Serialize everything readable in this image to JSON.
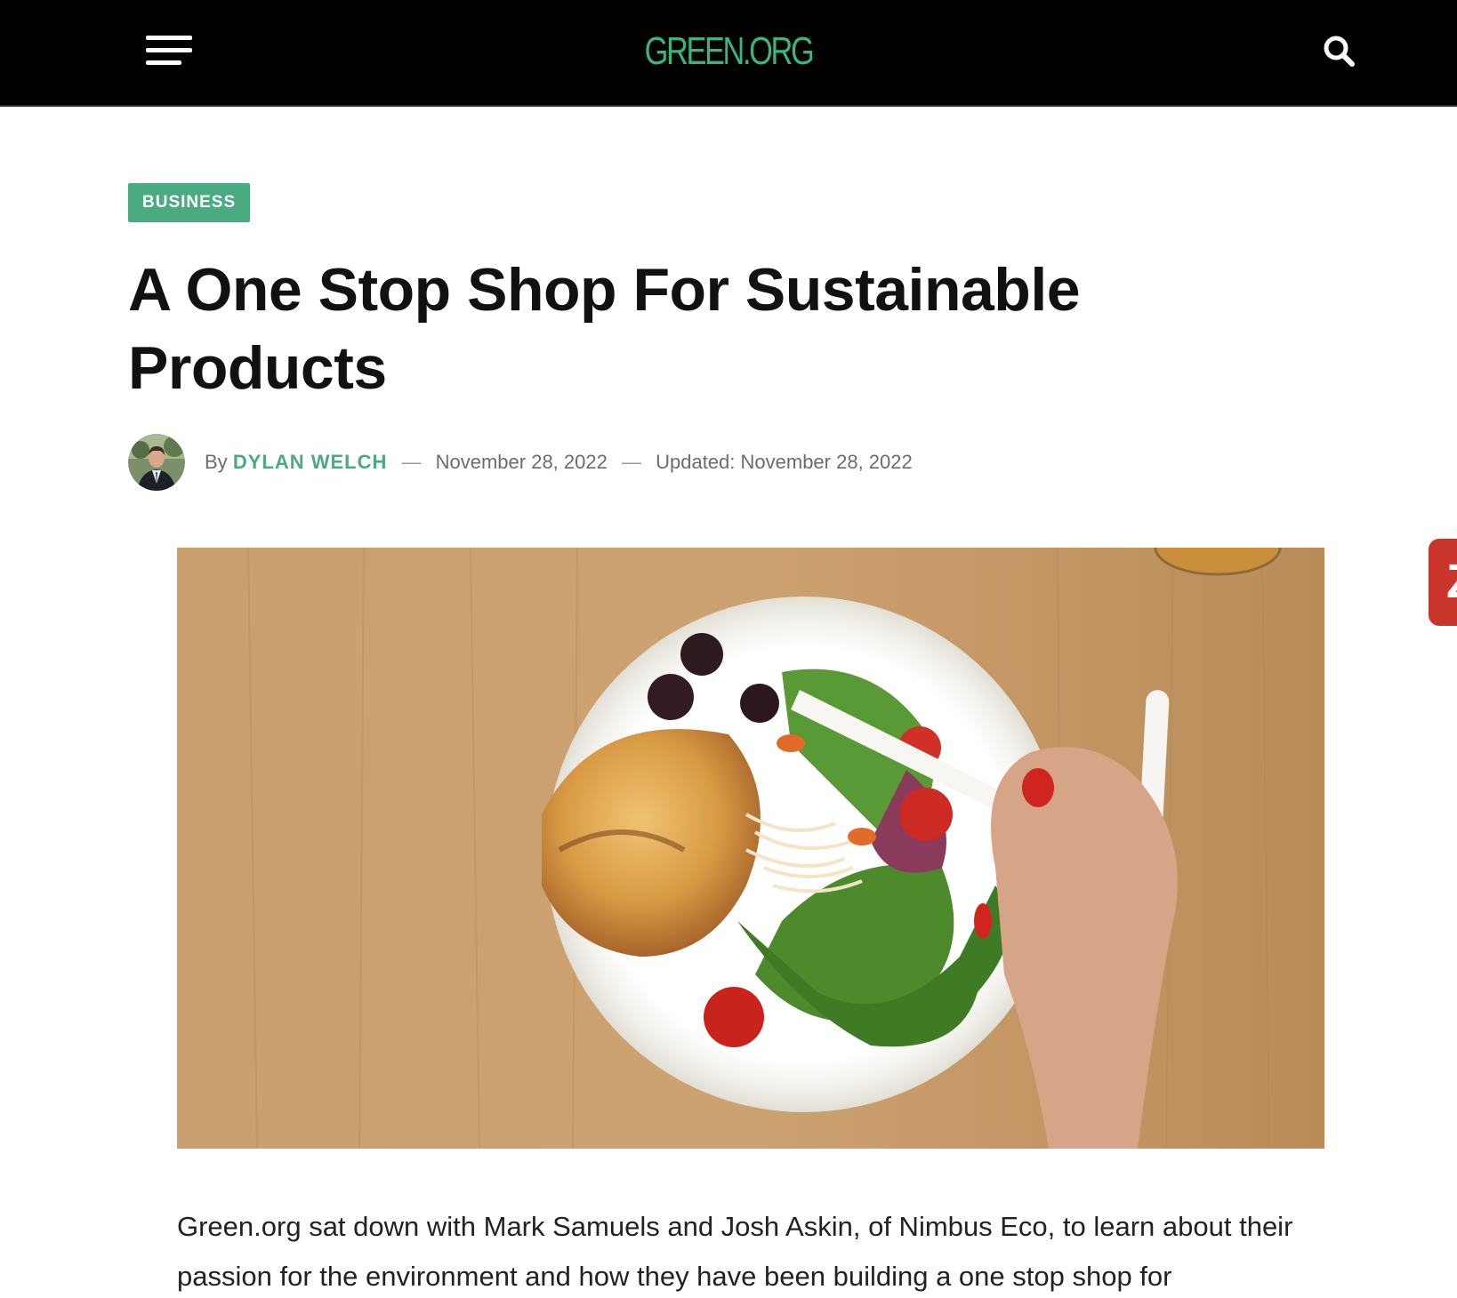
{
  "header": {
    "menu_icon": "hamburger-menu-icon",
    "logo_text": "GREEN.ORG",
    "search_icon": "search-icon",
    "background_color": "#000000",
    "logo_color": "#3ab57b"
  },
  "article": {
    "category": "BUSINESS",
    "category_color": "#4aaa82",
    "title": "A One Stop Shop For Sustainable Products",
    "byline_prefix": "By",
    "author": "DYLAN WELCH",
    "published_date": "November 28, 2022",
    "updated_label": "Updated:",
    "updated_date": "November 28, 2022",
    "separator": "—",
    "body": "Green.org sat down with Mark Samuels and Josh Askin, of Nimbus Eco, to learn about their passion for the environment and how they have been building a one stop shop for"
  },
  "side_tab": {
    "glyph": "Z",
    "color": "#c9352b"
  }
}
